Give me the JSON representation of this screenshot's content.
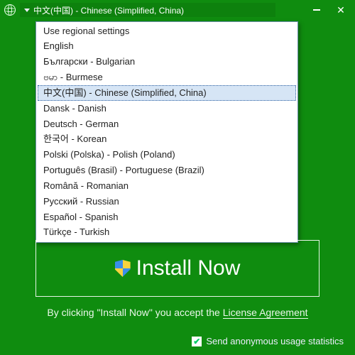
{
  "titlebar": {
    "current_language": "中文(中国) - Chinese (Simplified, China)"
  },
  "dropdown": {
    "selected_index": 4,
    "items": [
      "Use regional settings",
      "English",
      "Български - Bulgarian",
      "ဗမာ - Burmese",
      "中文(中国) - Chinese (Simplified, China)",
      "Dansk - Danish",
      "Deutsch - German",
      "한국어 - Korean",
      "Polski (Polska) - Polish (Poland)",
      "Português (Brasil) - Portuguese (Brazil)",
      "Română - Romanian",
      "Русский - Russian",
      "Español - Spanish",
      "Türkçe - Turkish"
    ]
  },
  "install": {
    "label": "Install Now"
  },
  "license": {
    "prefix": "By clicking \"Install Now\" you accept the ",
    "link": "License Agreement"
  },
  "stats": {
    "label": "Send anonymous usage statistics",
    "checked": true
  }
}
